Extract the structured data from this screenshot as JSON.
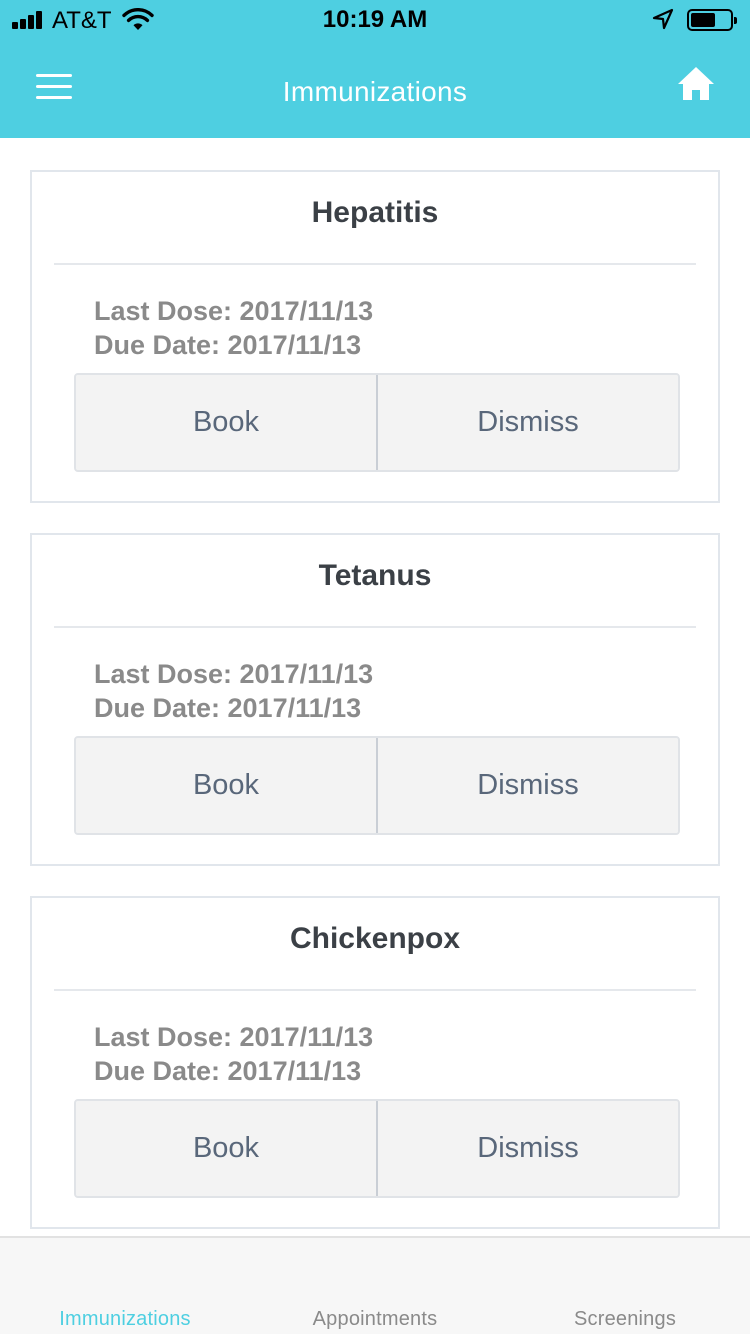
{
  "status_bar": {
    "carrier": "AT&T",
    "time": "10:19 AM"
  },
  "nav": {
    "title": "Immunizations"
  },
  "cards": [
    {
      "title": "Hepatitis",
      "last_dose": "Last Dose: 2017/11/13",
      "due_date": "Due Date: 2017/11/13",
      "book_label": "Book",
      "dismiss_label": "Dismiss"
    },
    {
      "title": "Tetanus",
      "last_dose": "Last Dose: 2017/11/13",
      "due_date": "Due Date: 2017/11/13",
      "book_label": "Book",
      "dismiss_label": "Dismiss"
    },
    {
      "title": "Chickenpox",
      "last_dose": "Last Dose: 2017/11/13",
      "due_date": "Due Date: 2017/11/13",
      "book_label": "Book",
      "dismiss_label": "Dismiss"
    }
  ],
  "tabs": [
    {
      "label": "Immunizations",
      "active": true
    },
    {
      "label": "Appointments",
      "active": false
    },
    {
      "label": "Screenings",
      "active": false
    }
  ],
  "colors": {
    "accent": "#4ecfe1",
    "card_border": "#e1e6ec",
    "button_bg": "#f3f3f3",
    "button_text": "#59677a",
    "title_text": "#3b4046",
    "meta_text": "#8a8a8a"
  },
  "icons": {
    "menu": "hamburger-menu-icon",
    "home": "home-icon",
    "signal": "cellular-signal-icon",
    "wifi": "wifi-icon",
    "location": "location-arrow-icon",
    "battery": "battery-icon"
  }
}
